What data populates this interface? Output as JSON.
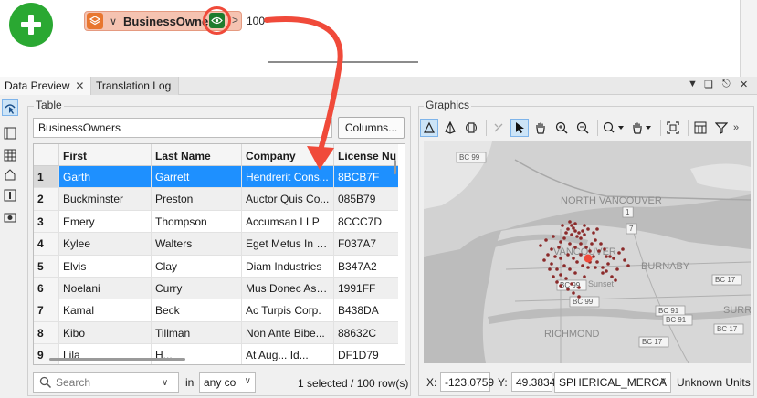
{
  "workspace": {
    "transformer_name": "BusinessOwner",
    "feature_count": "100"
  },
  "panel": {
    "tabs": [
      {
        "label": "Data Preview"
      },
      {
        "label": "Translation Log"
      }
    ]
  },
  "table": {
    "group_label": "Table",
    "selected_table": "BusinessOwners",
    "columns_button": "Columns...",
    "headers": [
      "",
      "First",
      "Last Name",
      "Company",
      "License Nu"
    ],
    "rows": [
      {
        "n": "1",
        "first": "Garth",
        "last": "Garrett",
        "company": "Hendrerit Cons...",
        "license": "8BCB7F"
      },
      {
        "n": "2",
        "first": "Buckminster",
        "last": "Preston",
        "company": "Auctor Quis Co...",
        "license": "085B79"
      },
      {
        "n": "3",
        "first": "Emery",
        "last": "Thompson",
        "company": "Accumsan LLP",
        "license": "8CCC7D"
      },
      {
        "n": "4",
        "first": "Kylee",
        "last": "Walters",
        "company": "Eget Metus In L...",
        "license": "F037A7"
      },
      {
        "n": "5",
        "first": "Elvis",
        "last": "Clay",
        "company": "Diam Industries",
        "license": "B347A2"
      },
      {
        "n": "6",
        "first": "Noelani",
        "last": "Curry",
        "company": "Mus Donec Ass...",
        "license": "1991FF"
      },
      {
        "n": "7",
        "first": "Kamal",
        "last": "Beck",
        "company": "Ac Turpis Corp.",
        "license": "B438DA"
      },
      {
        "n": "8",
        "first": "Kibo",
        "last": "Tillman",
        "company": "Non Ante Bibe...",
        "license": "88632C"
      },
      {
        "n": "9",
        "first": "Lila",
        "last": "H...",
        "company": "At Aug... Id...",
        "license": "DF1D79"
      }
    ],
    "selected_row_index": 0
  },
  "search": {
    "placeholder": "Search",
    "in_label": "in",
    "scope": "any co",
    "status": "1 selected / 100 row(s)"
  },
  "graphics": {
    "group_label": "Graphics",
    "map_labels": {
      "north_vancouver": "NORTH VANCOUVER",
      "vancouver": "VANCOUVER",
      "burnaby": "BURNABY",
      "richmond": "RICHMOND",
      "surrey": "SURRE",
      "sunset": "Sunset"
    },
    "road_shields": [
      "BC 99",
      "1",
      "7",
      "BC 99",
      "BC 17",
      "BC 91",
      "BC 91",
      "BC 99",
      "BC 17",
      "BC 17"
    ],
    "x_label": "X:",
    "x_value": "-123.0759",
    "y_label": "Y:",
    "y_value": "49.3834",
    "projection": "SPHERICAL_MERCA",
    "units": "Unknown Units"
  },
  "colors": {
    "accent_blue": "#1e90ff",
    "add_green": "#2aa832",
    "callout_red": "#f04a3a",
    "point_color": "#8b2a2a"
  }
}
